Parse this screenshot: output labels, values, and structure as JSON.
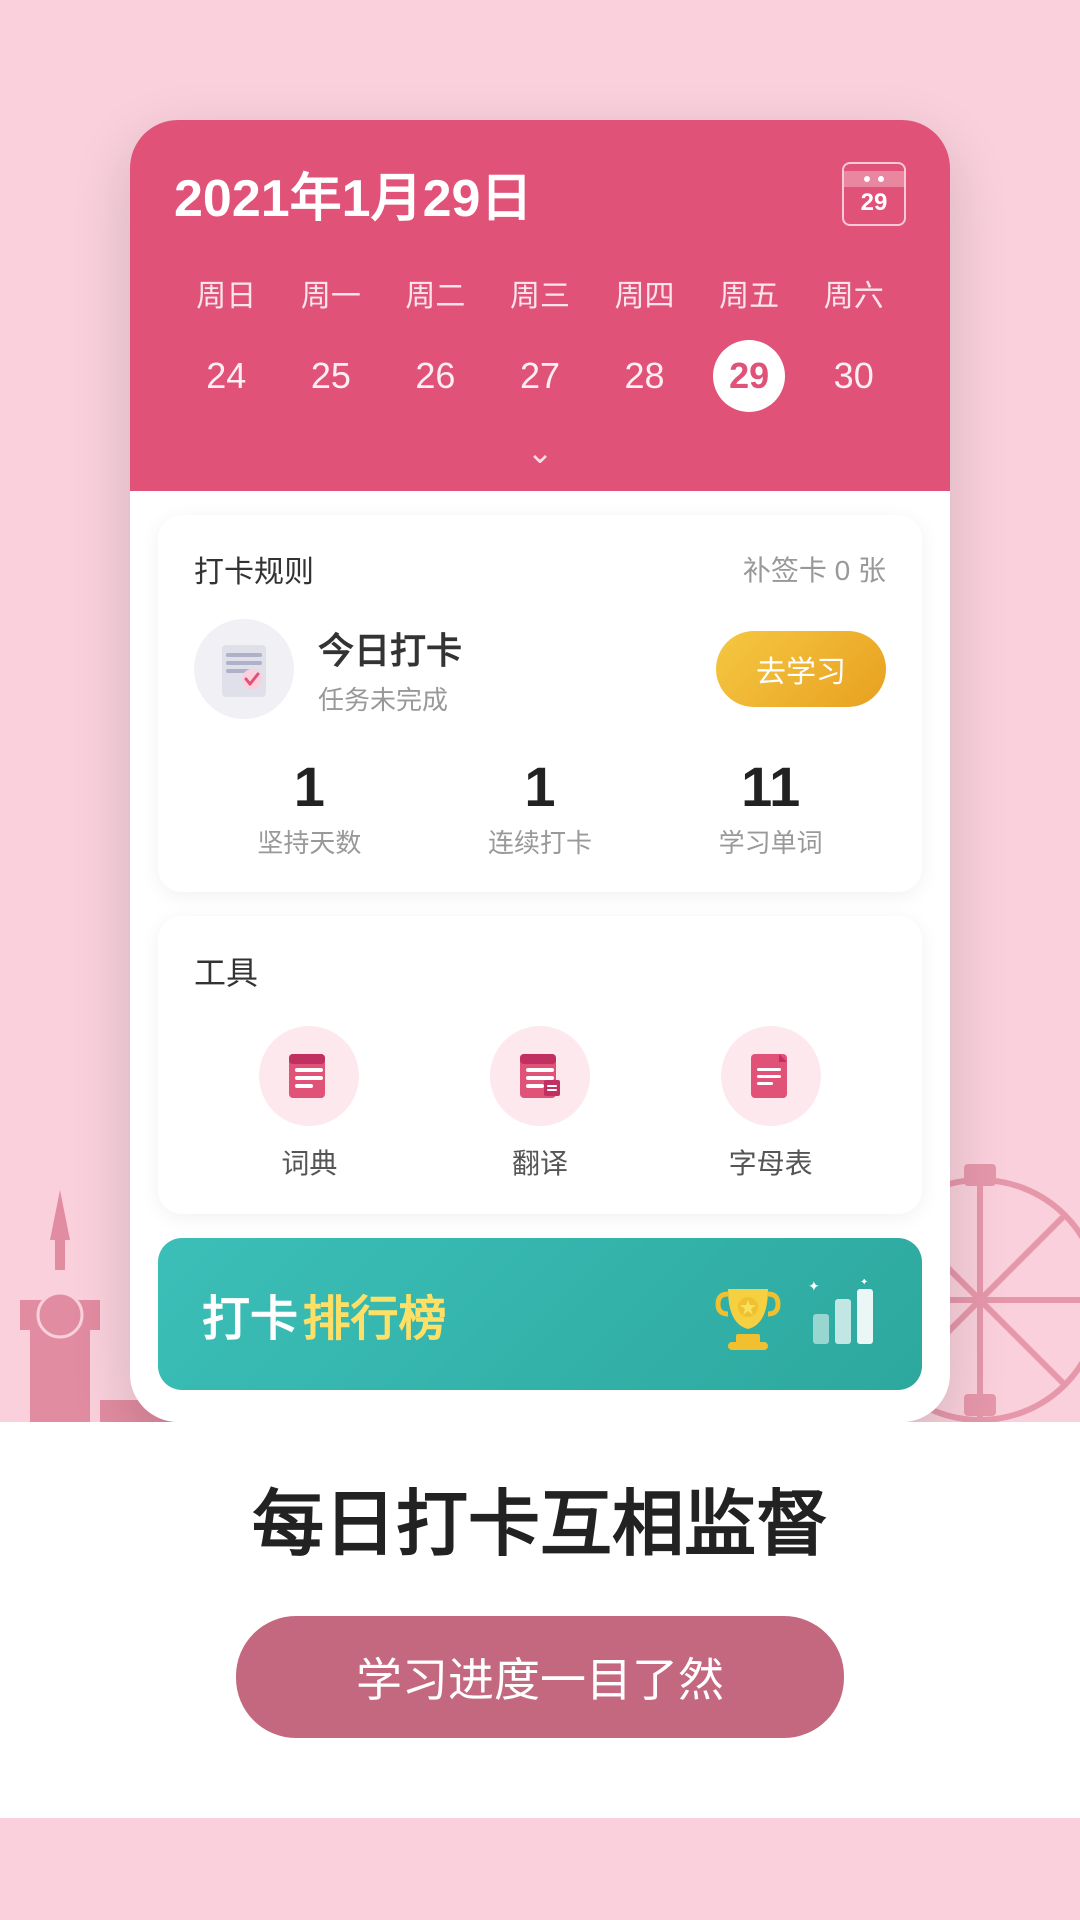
{
  "background_color": "#f9d0dc",
  "calendar": {
    "title": "2021年1月29日",
    "icon_num": "29",
    "weekdays": [
      "周日",
      "周一",
      "周二",
      "周三",
      "周四",
      "周五",
      "周六"
    ],
    "dates": [
      "24",
      "25",
      "26",
      "27",
      "28",
      "29",
      "30"
    ],
    "today": "29",
    "chevron": "∨"
  },
  "checkin_card": {
    "rules_label": "打卡规则",
    "supplement_label": "补签卡 0 张",
    "today_checkin_label": "今日打卡",
    "today_checkin_subtitle": "任务未完成",
    "go_study_label": "去学习",
    "stats": [
      {
        "num": "1",
        "label": "坚持天数"
      },
      {
        "num": "1",
        "label": "连续打卡"
      },
      {
        "num": "11",
        "label": "学习单词"
      }
    ]
  },
  "tools_card": {
    "title": "工具",
    "items": [
      {
        "label": "词典",
        "icon": "dictionary"
      },
      {
        "label": "翻译",
        "icon": "translate"
      },
      {
        "label": "字母表",
        "icon": "alphabet"
      }
    ]
  },
  "ranking_banner": {
    "text_prefix": "打卡",
    "text_highlight": "排行榜",
    "trophy_emoji": "🏆"
  },
  "bottom": {
    "main_text": "每日打卡互相监督",
    "cta_label": "学习进度一目了然"
  }
}
